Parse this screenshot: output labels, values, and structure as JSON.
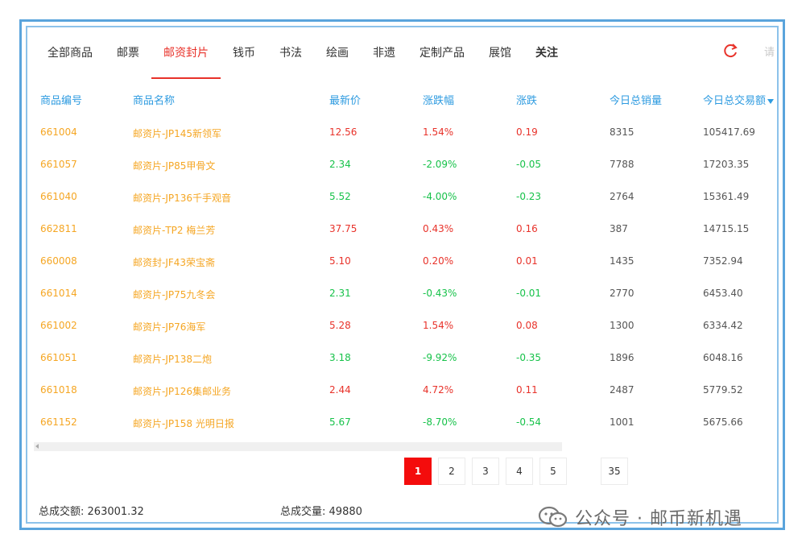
{
  "tabs": [
    {
      "label": "全部商品"
    },
    {
      "label": "邮票"
    },
    {
      "label": "邮资封片"
    },
    {
      "label": "钱币"
    },
    {
      "label": "书法"
    },
    {
      "label": "绘画"
    },
    {
      "label": "非遗"
    },
    {
      "label": "定制产品"
    },
    {
      "label": "展馆"
    },
    {
      "label": "关注"
    }
  ],
  "active_tab": "邮资封片",
  "search_hint": "请",
  "columns": {
    "code": "商品编号",
    "name": "商品名称",
    "price": "最新价",
    "change_pct": "涨跌幅",
    "change": "涨跌",
    "volume": "今日总销量",
    "turnover": "今日总交易额"
  },
  "rows": [
    {
      "code": "661004",
      "name": "邮资片-JP145新领军",
      "price": "12.56",
      "change_pct": "1.54%",
      "change": "0.19",
      "volume": "8315",
      "turnover": "105417.69",
      "trend": "up"
    },
    {
      "code": "661057",
      "name": "邮资片-JP85甲骨文",
      "price": "2.34",
      "change_pct": "-2.09%",
      "change": "-0.05",
      "volume": "7788",
      "turnover": "17203.35",
      "trend": "down"
    },
    {
      "code": "661040",
      "name": "邮资片-JP136千手观音",
      "price": "5.52",
      "change_pct": "-4.00%",
      "change": "-0.23",
      "volume": "2764",
      "turnover": "15361.49",
      "trend": "down"
    },
    {
      "code": "662811",
      "name": "邮资片-TP2 梅兰芳",
      "price": "37.75",
      "change_pct": "0.43%",
      "change": "0.16",
      "volume": "387",
      "turnover": "14715.15",
      "trend": "up"
    },
    {
      "code": "660008",
      "name": "邮资封-JF43荣宝斋",
      "price": "5.10",
      "change_pct": "0.20%",
      "change": "0.01",
      "volume": "1435",
      "turnover": "7352.94",
      "trend": "up"
    },
    {
      "code": "661014",
      "name": "邮资片-JP75九冬会",
      "price": "2.31",
      "change_pct": "-0.43%",
      "change": "-0.01",
      "volume": "2770",
      "turnover": "6453.40",
      "trend": "down"
    },
    {
      "code": "661002",
      "name": "邮资片-JP76海军",
      "price": "5.28",
      "change_pct": "1.54%",
      "change": "0.08",
      "volume": "1300",
      "turnover": "6334.42",
      "trend": "up"
    },
    {
      "code": "661051",
      "name": "邮资片-JP138二炮",
      "price": "3.18",
      "change_pct": "-9.92%",
      "change": "-0.35",
      "volume": "1896",
      "turnover": "6048.16",
      "trend": "down"
    },
    {
      "code": "661018",
      "name": "邮资片-JP126集邮业务",
      "price": "2.44",
      "change_pct": "4.72%",
      "change": "0.11",
      "volume": "2487",
      "turnover": "5779.52",
      "trend": "up"
    },
    {
      "code": "661152",
      "name": "邮资片-JP158 光明日报",
      "price": "5.67",
      "change_pct": "-8.70%",
      "change": "-0.54",
      "volume": "1001",
      "turnover": "5675.66",
      "trend": "down"
    }
  ],
  "pagination": {
    "pages": [
      "1",
      "2",
      "3",
      "4",
      "5"
    ],
    "last_page": "35",
    "current": "1"
  },
  "totals": {
    "turnover_label": "总成交额:",
    "turnover_value": "263001.32",
    "volume_label": "总成交量:",
    "volume_value": "49880"
  },
  "watermark": {
    "text": "公众号 · 邮币新机遇"
  },
  "colors": {
    "accent_red": "#e8322a",
    "up": "#e8322a",
    "down": "#17c24a",
    "link_yellow": "#f5a623",
    "header_blue": "#2e9be0",
    "frame_blue": "#5aa4dc"
  }
}
